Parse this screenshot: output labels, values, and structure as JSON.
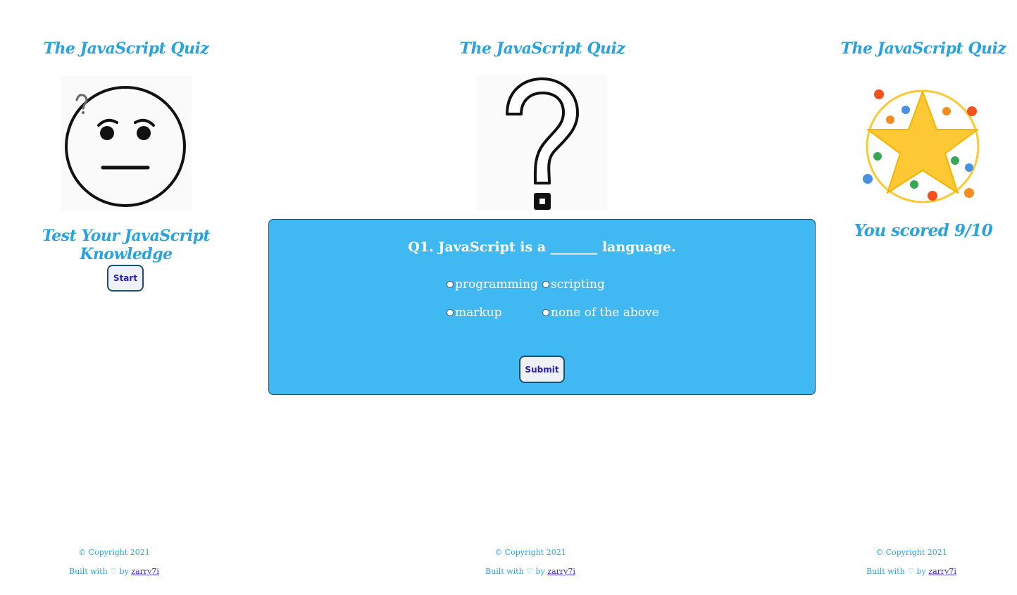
{
  "app_title": "The JavaScript Quiz",
  "start_screen": {
    "subtitle": "Test Your JavaScript Knowledge",
    "start_label": "Start"
  },
  "quiz_screen": {
    "question": "Q1. JavaScript is a _______ language.",
    "options": [
      "programming",
      "scripting",
      "markup",
      "none of the above"
    ],
    "submit_label": "Submit"
  },
  "result_screen": {
    "score_text": "You scored 9/10"
  },
  "footer": {
    "copyright": "© Copyright 2021",
    "built_prefix": "Built with ♡ by",
    "author": "zarry7i"
  },
  "colors": {
    "title": "#29a3dc",
    "card": "#40b9f3",
    "button_text": "#2a1fb0"
  },
  "icons": [
    "thinking-face-icon",
    "question-mark-icon",
    "star-confetti-icon",
    "heart-icon"
  ]
}
